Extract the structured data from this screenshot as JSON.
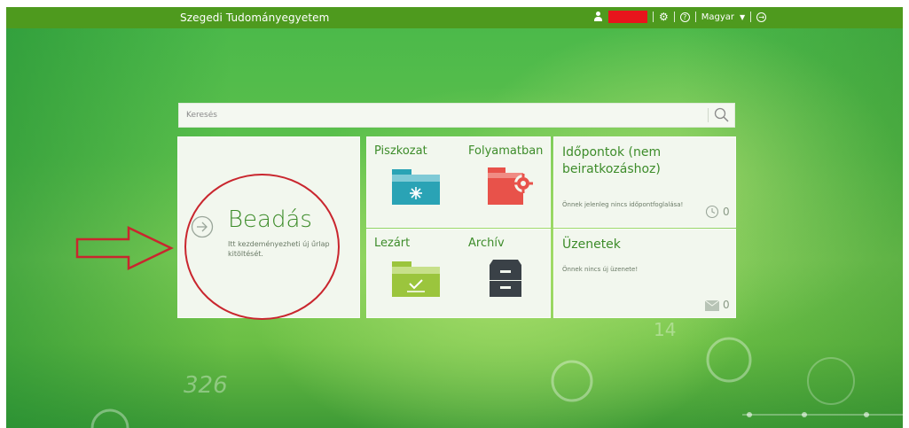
{
  "topbar": {
    "brand": "Szegedi Tudományegyetem",
    "language": "Magyar",
    "user_icon": "user-icon",
    "settings_icon": "gear-icon",
    "help_icon": "help-icon",
    "logout_icon": "logout-icon"
  },
  "search": {
    "placeholder": "Keresés",
    "icon": "search-icon"
  },
  "tiles": {
    "beadas": {
      "title": "Beadás",
      "description": "Itt kezdeményezheti új űrlap kitöltését.",
      "icon": "arrow-right-circle-icon"
    },
    "piszkozat": {
      "label": "Piszkozat",
      "icon": "draft-folder-icon"
    },
    "folyamatban": {
      "label": "Folyamatban",
      "icon": "in-progress-folder-icon"
    },
    "lezart": {
      "label": "Lezárt",
      "icon": "closed-folder-icon"
    },
    "archiv": {
      "label": "Archív",
      "icon": "archive-cabinet-icon"
    },
    "idopontok": {
      "title": "Időpontok (nem beiratkozáshoz)",
      "description": "Önnek jelenleg nincs időpontfoglalása!",
      "count": "0",
      "icon": "clock-icon"
    },
    "uzenetek": {
      "title": "Üzenetek",
      "description": "Önnek nincs új üzenete!",
      "count": "0",
      "icon": "envelope-icon"
    }
  },
  "background": {
    "number_1": "326",
    "number_2": "14"
  },
  "colors": {
    "topbar": "#4e9a1e",
    "accent_green": "#3d8c2a",
    "annotation_red": "#c9262e",
    "folder_teal": "#2aa3b5",
    "folder_red": "#e8524a",
    "folder_green": "#9bc53d"
  }
}
